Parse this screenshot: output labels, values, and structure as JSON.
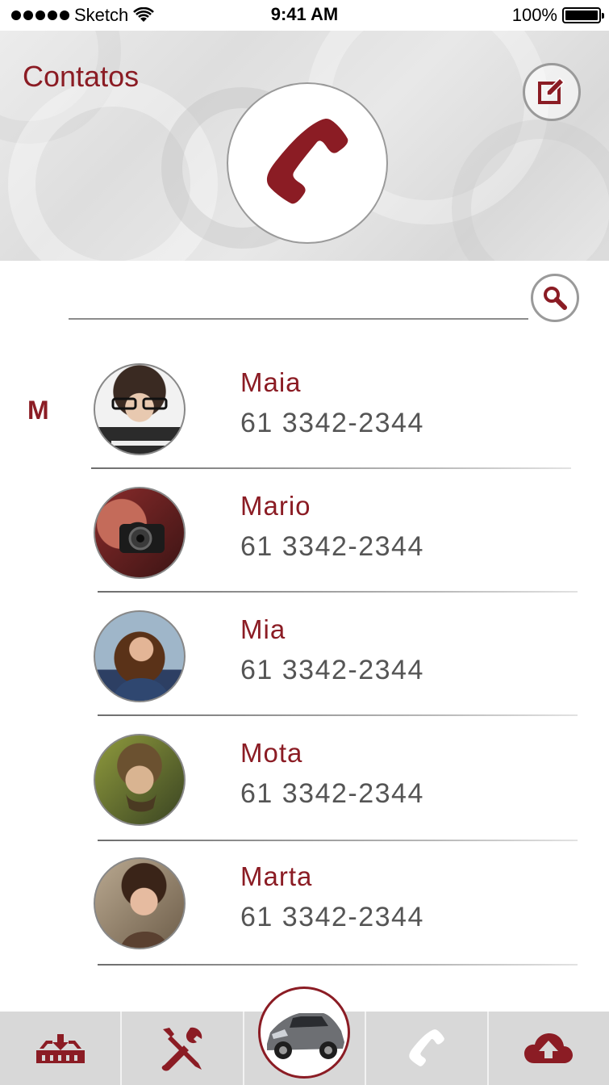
{
  "status_bar": {
    "carrier": "Sketch",
    "time": "9:41 AM",
    "battery": "100%",
    "icons": [
      "signal-dots-icon",
      "wifi-icon",
      "battery-icon"
    ]
  },
  "header": {
    "title": "Contatos",
    "edit_icon": "edit-icon",
    "call_icon": "phone-icon"
  },
  "search": {
    "value": "",
    "placeholder": "",
    "icon": "search-icon"
  },
  "contacts": {
    "section_letter": "M",
    "items": [
      {
        "name": "Maia",
        "phone": "61 3342-2344",
        "avatar": "avatar-photo"
      },
      {
        "name": "Mario",
        "phone": "61 3342-2344",
        "avatar": "avatar-photo"
      },
      {
        "name": "Mia",
        "phone": "61 3342-2344",
        "avatar": "avatar-photo"
      },
      {
        "name": "Mota",
        "phone": "61 3342-2344",
        "avatar": "avatar-photo"
      },
      {
        "name": "Marta",
        "phone": "61 3342-2344",
        "avatar": "avatar-photo"
      }
    ]
  },
  "tab_bar": {
    "tabs": [
      {
        "icon": "download-tray-icon",
        "active": false
      },
      {
        "icon": "tools-icon",
        "active": false
      },
      {
        "icon": "car-icon",
        "active": true
      },
      {
        "icon": "phone-icon",
        "active": false
      },
      {
        "icon": "cloud-upload-icon",
        "active": false
      }
    ]
  },
  "colors": {
    "accent": "#8b1c24",
    "text_secondary": "#555555",
    "tab_bar_bg": "#d8d8d8"
  }
}
